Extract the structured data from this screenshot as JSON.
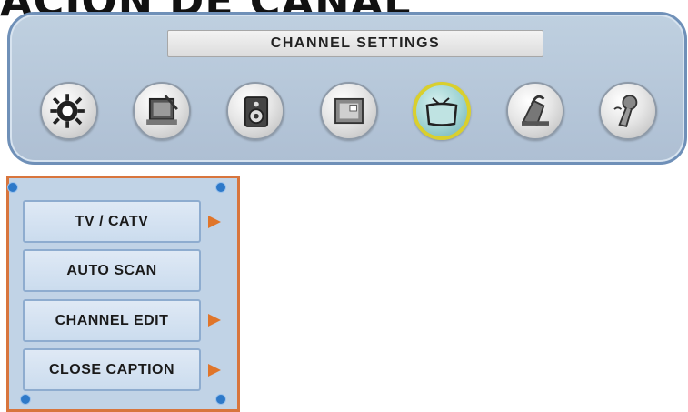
{
  "page": {
    "heading": "ACION DE CANAL"
  },
  "osd": {
    "title": "CHANNEL SETTINGS",
    "icons": [
      {
        "name": "picture-settings-icon",
        "active": false
      },
      {
        "name": "setup-icon",
        "active": false
      },
      {
        "name": "audio-icon",
        "active": false
      },
      {
        "name": "pc-display-icon",
        "active": false
      },
      {
        "name": "tv-channel-icon",
        "active": true
      },
      {
        "name": "parental-lock-icon",
        "active": false
      },
      {
        "name": "options-icon",
        "active": false
      }
    ]
  },
  "submenu": {
    "items": [
      {
        "label": "TV / CATV",
        "has_arrow": true
      },
      {
        "label": "AUTO SCAN",
        "has_arrow": false
      },
      {
        "label": "CHANNEL EDIT",
        "has_arrow": true
      },
      {
        "label": "CLOSE CAPTION",
        "has_arrow": true
      }
    ]
  },
  "colors": {
    "panel_bg": "#aebfd3",
    "panel_border": "#6f90b8",
    "submenu_border": "#d8753d",
    "arrow": "#e0752a",
    "active_ring": "#d9cf2d",
    "corner_dot": "#2e79c9"
  }
}
